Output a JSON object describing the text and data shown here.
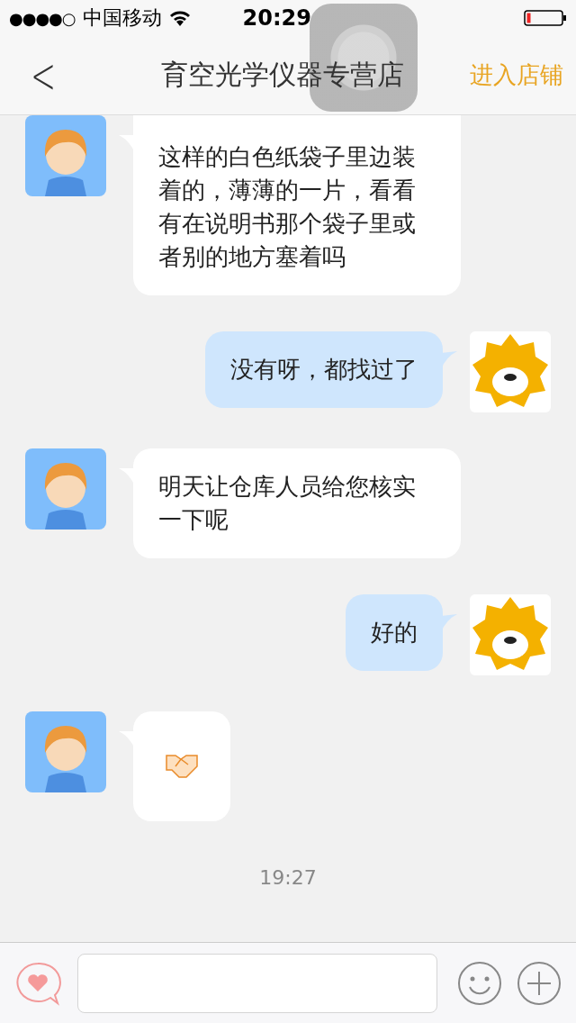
{
  "status_bar": {
    "signal": "●●●●○",
    "carrier": "中国移动",
    "time": "20:29",
    "battery_low": true
  },
  "nav": {
    "back": "<",
    "title": "育空光学仪器专营店",
    "action": "进入店铺"
  },
  "messages": [
    {
      "outgoing": false,
      "kind": "text",
      "text": "这样的白色纸袋子里边装着的，薄薄的一片，看看有在说明书那个袋子里或者别的地方塞着吗"
    },
    {
      "outgoing": true,
      "kind": "text",
      "text": "没有呀，都找过了"
    },
    {
      "outgoing": false,
      "kind": "text",
      "text": "明天让仓库人员给您核实一下呢"
    },
    {
      "outgoing": true,
      "kind": "text",
      "text": "好的"
    },
    {
      "outgoing": false,
      "kind": "sticker"
    }
  ],
  "timestamp": "19:27"
}
